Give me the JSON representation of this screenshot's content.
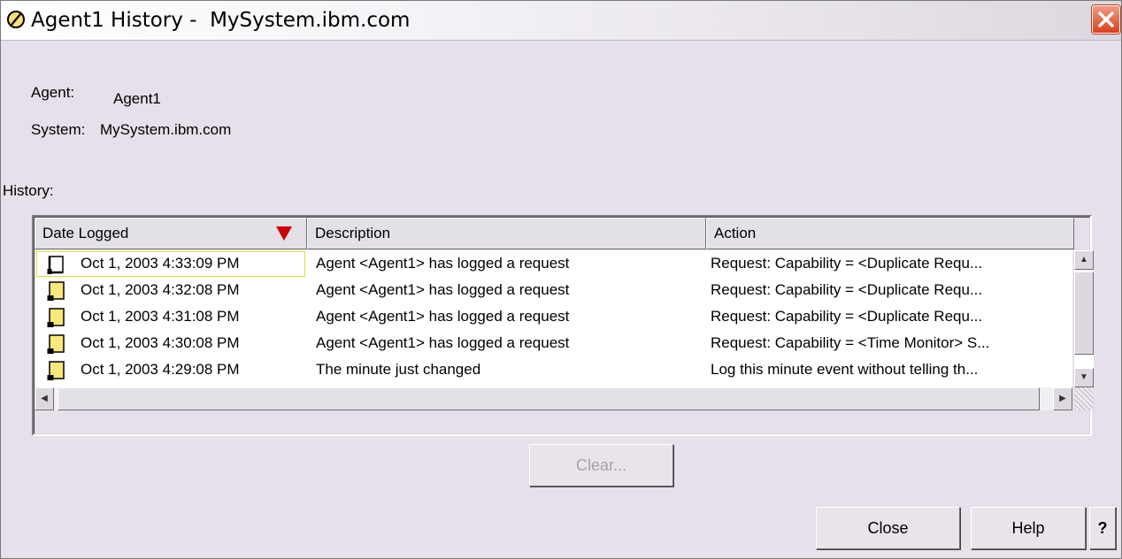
{
  "window": {
    "title": "Agent1 History -  MySystem.ibm.com"
  },
  "info": {
    "agent_label": "Agent:",
    "agent_value": "Agent1",
    "system_label": "System:",
    "system_value": "MySystem.ibm.com"
  },
  "history_label": "History:",
  "table": {
    "columns": [
      "Date Logged",
      "Description",
      "Action"
    ],
    "sort_column": "Date Logged",
    "sort_indicator_color": "#cc0000",
    "rows": [
      {
        "date": "Oct 1, 2003 4:33:09 PM",
        "description": "Agent <Agent1> has logged a request",
        "action": "Request: Capability = <Duplicate Requ..."
      },
      {
        "date": "Oct 1, 2003 4:32:08 PM",
        "description": "Agent <Agent1> has logged a request",
        "action": "Request: Capability = <Duplicate Requ..."
      },
      {
        "date": "Oct 1, 2003 4:31:08 PM",
        "description": "Agent <Agent1> has logged a request",
        "action": "Request: Capability = <Duplicate Requ..."
      },
      {
        "date": "Oct 1, 2003 4:30:08 PM",
        "description": "Agent <Agent1> has logged a request",
        "action": "Request: Capability = <Time Monitor> S..."
      },
      {
        "date": "Oct 1, 2003 4:29:08 PM",
        "description": "The minute just changed",
        "action": "Log this minute event without telling th..."
      }
    ],
    "selected_row": 0,
    "row_icon": "document-icon"
  },
  "buttons": {
    "clear": "Clear...",
    "close": "Close",
    "help": "Help",
    "whats_this": "?"
  },
  "colors": {
    "background": "#e7dfe9",
    "close_button": "#d9401c",
    "selection_border": "#e8d84a"
  }
}
